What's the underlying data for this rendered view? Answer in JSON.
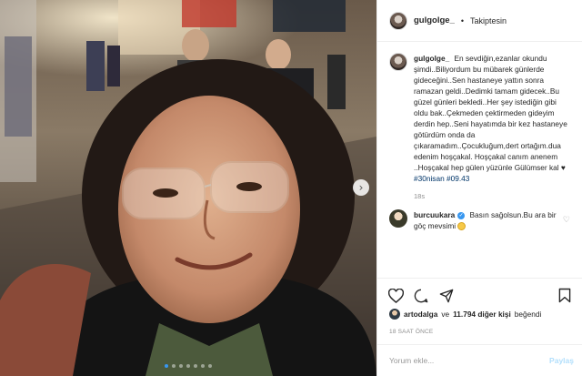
{
  "post": {
    "carousel": {
      "slide_count": 7,
      "active_index": 0
    },
    "next_arrow": "›"
  },
  "header": {
    "username": "gulgolge_",
    "separator": "•",
    "follow_state": "Takiptesin"
  },
  "caption": {
    "author": "gulgolge_",
    "text": "En sevdiğin,ezanlar okundu şimdi..Biliyordum bu mübarek günlerde gideceğini..Sen hastaneye yattın sonra ramazan geldi..Dedimki tamam gidecek..Bu güzel günleri bekledi..Her şey istediğin gibi oldu bak..Çekmeden çektirmeden gideyim derdin hep..Seni hayatımda bir kez hastaneye götürdüm onda da çıkaramadım..Çocukluğum,dert ortağım.dua edenim hoşçakal. Hoşçakal canım anenem ..Hoşçakal hep gülen yüzünle Gülümser kal ♥",
    "tags": [
      "#30nisan",
      "#09.43"
    ],
    "time": "18s"
  },
  "comment": {
    "author": "burcuukara",
    "text": "Basın sağolsun.Bu ara bir göç mevsimi"
  },
  "likes": {
    "first_liker": "artodalga",
    "connector": "ve",
    "count_text": "11.794 diğer kişi",
    "suffix": "beğendi"
  },
  "post_time": "18 SAAT ÖNCE",
  "add_comment": {
    "placeholder": "Yorum ekle...",
    "share_label": "Paylaş"
  },
  "colors": {
    "link": "#003569",
    "active_dot": "#3897f0",
    "verified": "#3897f0"
  }
}
